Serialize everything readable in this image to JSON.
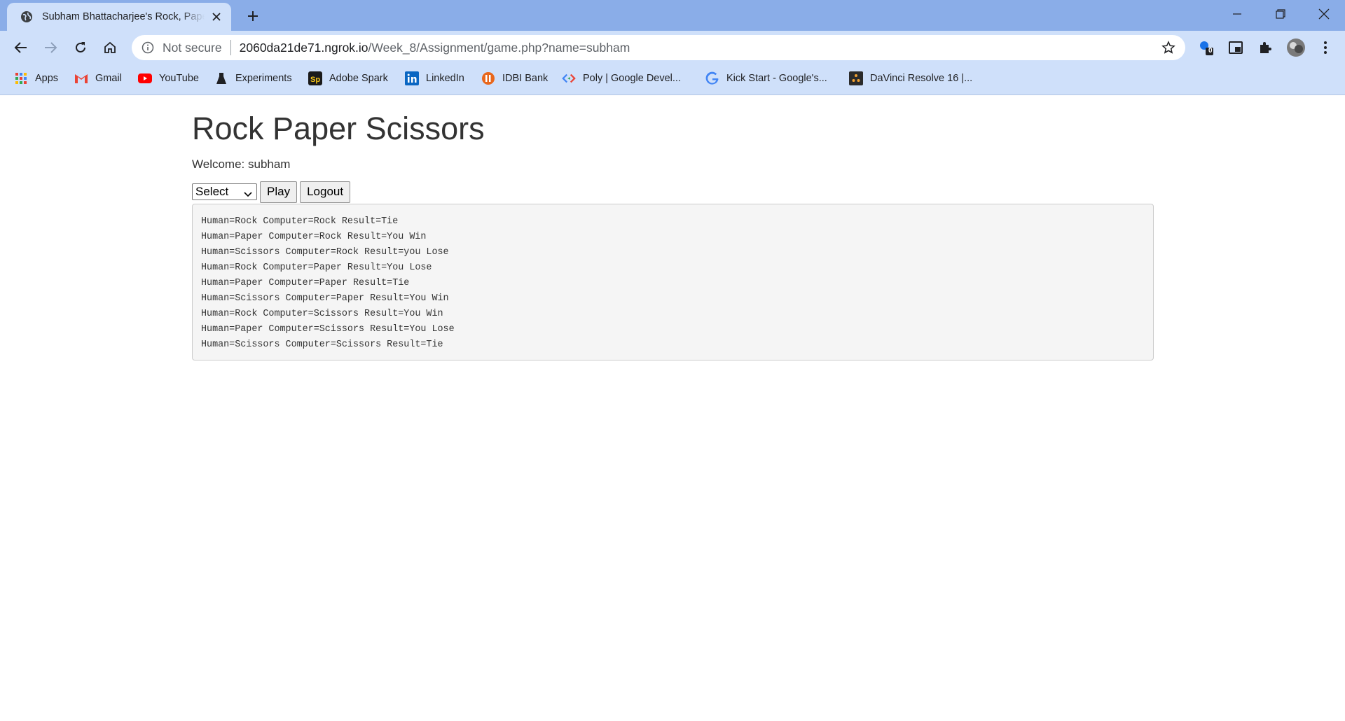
{
  "browser": {
    "tab_title": "Subham Bhattacharjee's Rock, Paper, Scissors",
    "new_tab_icon": "plus-icon",
    "url_security": "Not secure",
    "url_host": "2060da21de71.ngrok.io",
    "url_path": "/Week_8/Assignment/game.php?name=subham",
    "extension_badge": "0",
    "bookmarks": [
      {
        "label": "Apps",
        "icon": "apps-grid-icon"
      },
      {
        "label": "Gmail",
        "icon": "gmail-icon"
      },
      {
        "label": "YouTube",
        "icon": "youtube-icon"
      },
      {
        "label": "Experiments",
        "icon": "flask-icon"
      },
      {
        "label": "Adobe Spark",
        "icon": "adobe-spark-icon"
      },
      {
        "label": "LinkedIn",
        "icon": "linkedin-icon"
      },
      {
        "label": "IDBI Bank",
        "icon": "idbi-icon"
      },
      {
        "label": "Poly | Google Devel...",
        "icon": "poly-icon"
      },
      {
        "label": "Kick Start - Google's...",
        "icon": "google-icon"
      },
      {
        "label": "DaVinci Resolve 16 |...",
        "icon": "davinci-icon"
      }
    ]
  },
  "page": {
    "title": "Rock Paper Scissors",
    "welcome": "Welcome: subham",
    "select_value": "Select",
    "play_label": "Play",
    "logout_label": "Logout",
    "results": [
      "Human=Rock Computer=Rock Result=Tie",
      "Human=Paper Computer=Rock Result=You Win",
      "Human=Scissors Computer=Rock Result=you Lose",
      "Human=Rock Computer=Paper Result=You Lose",
      "Human=Paper Computer=Paper Result=Tie",
      "Human=Scissors Computer=Paper Result=You Win",
      "Human=Rock Computer=Scissors Result=You Win",
      "Human=Paper Computer=Scissors Result=You Lose",
      "Human=Scissors Computer=Scissors Result=Tie"
    ]
  }
}
